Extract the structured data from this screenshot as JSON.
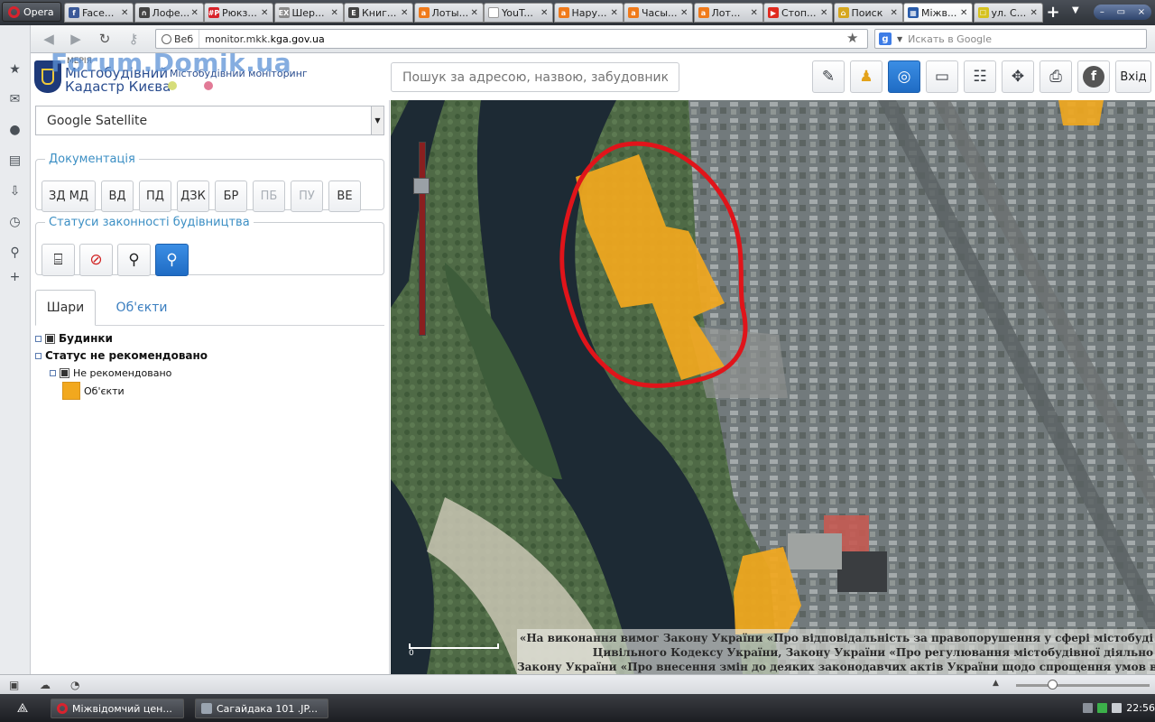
{
  "browser": {
    "opera_label": "Opera",
    "tabs": [
      {
        "label": "Face...",
        "fav_color": "#3b5998",
        "fav_text": "f"
      },
      {
        "label": "Лофе...",
        "fav_color": "#444444",
        "fav_text": "∩"
      },
      {
        "label": "Рюкз...",
        "fav_color": "#d8232a",
        "fav_text": "#P"
      },
      {
        "label": "Шер...",
        "fav_color": "#8a8a8a",
        "fav_text": "EX"
      },
      {
        "label": "Книг...",
        "fav_color": "#444444",
        "fav_text": "E"
      },
      {
        "label": "Лоты...",
        "fav_color": "#f07a1a",
        "fav_text": "a"
      },
      {
        "label": "YouT...",
        "fav_color": "#ffffff",
        "fav_text": ""
      },
      {
        "label": "Нару...",
        "fav_color": "#f07a1a",
        "fav_text": "a"
      },
      {
        "label": "Часы...",
        "fav_color": "#f07a1a",
        "fav_text": "a"
      },
      {
        "label": "Лот...",
        "fav_color": "#f07a1a",
        "fav_text": "a"
      },
      {
        "label": "Стоп...",
        "fav_color": "#e02a1f",
        "fav_text": "▶"
      },
      {
        "label": "Поиск",
        "fav_color": "#d6a71f",
        "fav_text": "⌂"
      },
      {
        "label": "Міжв...",
        "fav_color": "#2a5caa",
        "fav_text": "▦",
        "active": true
      },
      {
        "label": "ул. С...",
        "fav_color": "#d6c21f",
        "fav_text": "☐"
      }
    ],
    "url_badge": "Веб",
    "url_prefix": "monitor.mkk.",
    "url_host": "kga.gov.ua",
    "google_placeholder": "Искать в Google"
  },
  "app": {
    "logo_small": "МЕРІЯ",
    "logo_line1": "Містобудівний",
    "logo_line2": "Кадастр Києва",
    "logo_monitoring": "Містобудівний моніторинг",
    "watermark": "Forum.Domik.ua",
    "search_placeholder": "Пошук за адресою, назвою, забудовником...",
    "exit_label": "Вхід",
    "base_layer": "Google Satellite",
    "docs_legend": "Документація",
    "doc_buttons": [
      "ЗД МД",
      "ВД",
      "ПД",
      "ДЗК",
      "БР",
      "ПБ",
      "ПУ",
      "ВЕ"
    ],
    "status_legend": "Статуси законності будівництва",
    "tab_layers": "Шари",
    "tab_objects": "Об'єкти",
    "tree": {
      "buildings": "Будинки",
      "status_not_recommended": "Статус не рекомендовано",
      "not_recommended": "Не рекомендовано",
      "objects": "Об'єкти"
    },
    "legal_lines": [
      "«На виконання вимог Закону України «Про відповідальність за правопорушення у сфері містобуді",
      "Цивільного Кодексу України, Закону України «Про регулювання містобудівної діяльно",
      "Закону України «Про внесення змін до деяких законодавчих актів України щодо спрощення умов веденн"
    ],
    "scale_zero": "0",
    "colors": {
      "accent": "#1f6cc4",
      "highlight": "#f2a81e",
      "annotation": "#e0141a"
    }
  },
  "taskbar": {
    "tasks": [
      "Міжвідомчий цен...",
      "Сагайдака 101 .JP..."
    ],
    "time": "22:56"
  }
}
